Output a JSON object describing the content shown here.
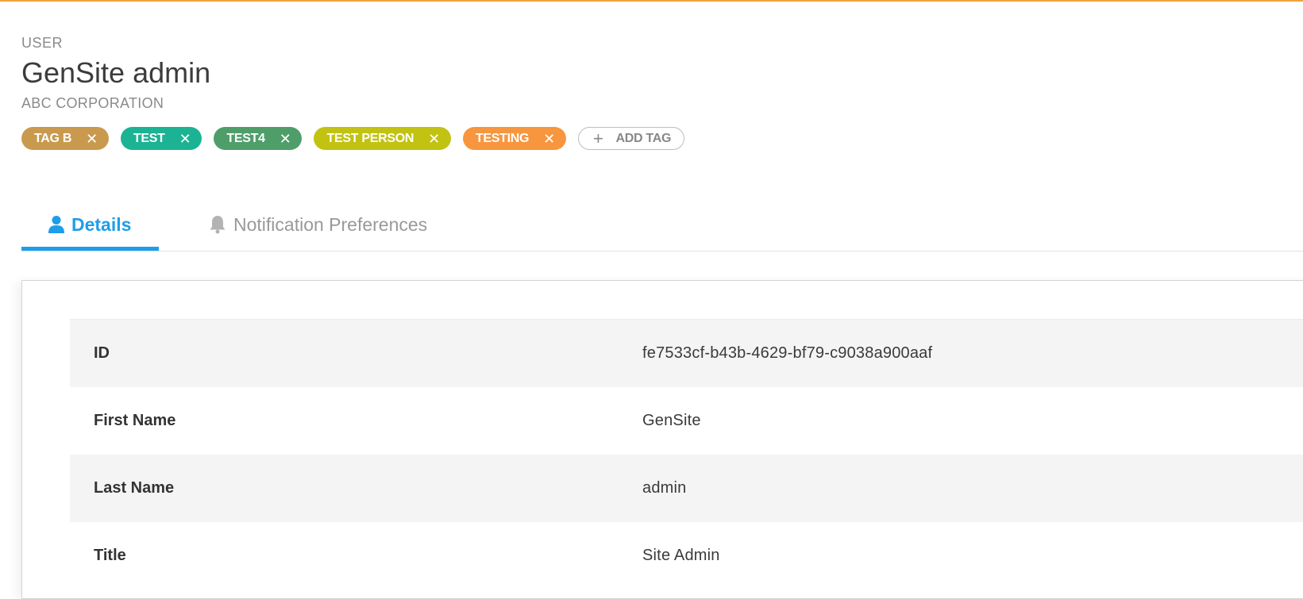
{
  "colors": {
    "accent_top": "#f0a33c",
    "tab_active": "#1e9ee8",
    "tab_inactive": "#999999"
  },
  "header": {
    "entity_type": "USER",
    "name": "GenSite admin",
    "organization": "ABC CORPORATION"
  },
  "tags": [
    {
      "label": "TAG B",
      "color": "#c99a4e",
      "close_icon": "close-icon"
    },
    {
      "label": "TEST",
      "color": "#1bb394",
      "close_icon": "close-icon"
    },
    {
      "label": "TEST4",
      "color": "#4f9e6a",
      "close_icon": "close-icon"
    },
    {
      "label": "TEST PERSON",
      "color": "#c2c212",
      "close_icon": "close-icon"
    },
    {
      "label": "TESTING",
      "color": "#f7963e",
      "close_icon": "close-icon"
    }
  ],
  "add_tag": {
    "label": "ADD TAG",
    "icon": "plus-icon"
  },
  "tabs": [
    {
      "label": "Details",
      "icon": "user-icon",
      "active": true
    },
    {
      "label": "Notification Preferences",
      "icon": "bell-icon",
      "active": false
    }
  ],
  "details": {
    "rows": [
      {
        "label": "ID",
        "value": "fe7533cf-b43b-4629-bf79-c9038a900aaf"
      },
      {
        "label": "First Name",
        "value": "GenSite"
      },
      {
        "label": "Last Name",
        "value": "admin"
      },
      {
        "label": "Title",
        "value": "Site Admin"
      }
    ]
  }
}
